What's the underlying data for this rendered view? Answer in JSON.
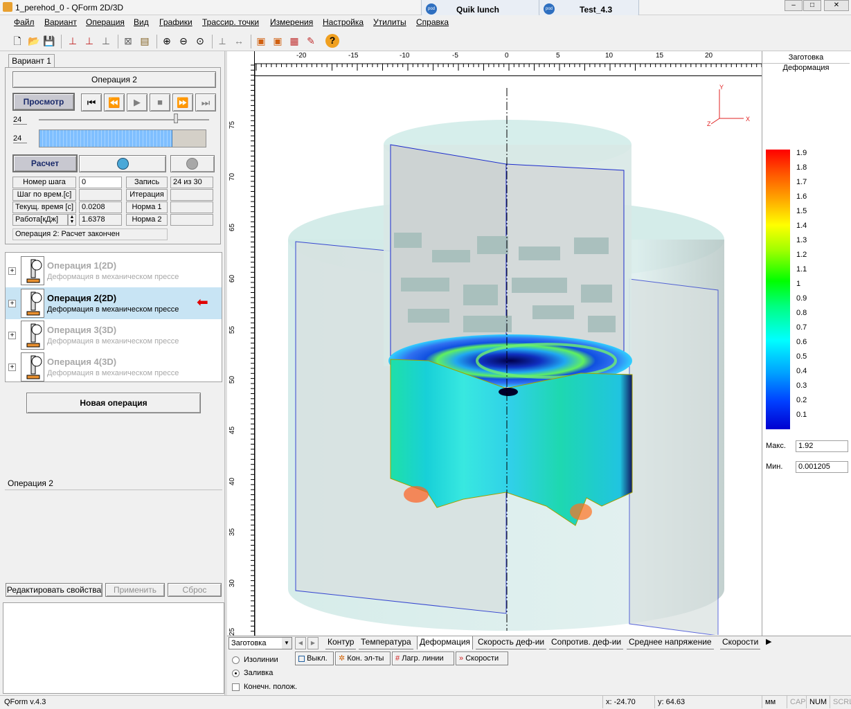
{
  "window": {
    "title": "1_perehod_0 - QForm 2D/3D"
  },
  "external_tabs": [
    {
      "label": "Quik lunch"
    },
    {
      "label": "Test_4.3"
    }
  ],
  "window_buttons": {
    "minimize": "–",
    "maximize": "□",
    "close": "✕"
  },
  "menu": [
    "Файл",
    "Вариант",
    "Операция",
    "Вид",
    "Графики",
    "Трассир. точки",
    "Измерения",
    "Настройка",
    "Утилиты",
    "Справка"
  ],
  "variant_tab": "Вариант 1",
  "operation_header": "Операция 2",
  "controls": {
    "preview_label": "Просмотр",
    "calc_label": "Расчет",
    "step_value_1": "24",
    "step_value_2": "24",
    "progress_fraction": 0.8
  },
  "info": {
    "step_num_label": "Номер шага",
    "step_num_value": "0",
    "record_label": "Запись",
    "record_value": "24 из 30",
    "time_step_label": "Шаг по врем.[с]",
    "time_step_value": "",
    "iteration_label": "Итерация",
    "iteration_value": "",
    "cur_time_label": "Текущ. время [с]",
    "cur_time_value": "0.0208",
    "norm1_label": "Норма 1",
    "norm1_value": "",
    "work_label": "Работа[кДж]",
    "work_value": "1.6378",
    "norm2_label": "Норма 2",
    "norm2_value": "",
    "status": "Операция 2: Расчет закончен"
  },
  "operations": [
    {
      "title": "Операция 1(2D)",
      "subtitle": "Деформация в механическом прессе",
      "active": false
    },
    {
      "title": "Операция 2(2D)",
      "subtitle": "Деформация в механическом прессе",
      "active": true
    },
    {
      "title": "Операция 3(3D)",
      "subtitle": "Деформация в механическом прессе",
      "active": false
    },
    {
      "title": "Операция 4(3D)",
      "subtitle": "Деформация в механическом прессе",
      "active": false
    }
  ],
  "new_operation_label": "Новая операция",
  "properties": {
    "title": "Операция 2",
    "edit_label": "Редактировать свойства",
    "apply_label": "Применить",
    "reset_label": "Сброс"
  },
  "ruler": {
    "x_ticks": [
      "-20",
      "-15",
      "-10",
      "-5",
      "0",
      "5",
      "10",
      "15",
      "20"
    ],
    "y_ticks": [
      "75",
      "70",
      "65",
      "60",
      "55",
      "50",
      "45",
      "40",
      "35",
      "30",
      "25"
    ]
  },
  "axes": {
    "x": "X",
    "y": "Y",
    "z": "Z"
  },
  "legend": {
    "title1": "Заготовка",
    "title2": "Деформация",
    "scale": [
      "1.9",
      "1.8",
      "1.7",
      "1.6",
      "1.5",
      "1.4",
      "1.3",
      "1.2",
      "1.1",
      "1",
      "0.9",
      "0.8",
      "0.7",
      "0.6",
      "0.5",
      "0.4",
      "0.3",
      "0.2",
      "0.1"
    ],
    "max_label": "Макс.",
    "max_value": "1.92",
    "min_label": "Мин.",
    "min_value": "0.001205"
  },
  "object_select": "Заготовка",
  "view_tabs": [
    "Контур",
    "Температура",
    "Деформация",
    "Скорость деф-ии",
    "Сопротив. деф-ии",
    "Среднее напряжение",
    "Скорости"
  ],
  "active_view_tab": "Деформация",
  "display": {
    "isolines": "Изолинии",
    "fill": "Заливка",
    "final_pos": "Конечн. полож.",
    "off_btn": "Выкл.",
    "end_elements_btn": "Кон. эл-ты",
    "lagr_btn": "Лагр. линии",
    "speeds_btn": "Скорости"
  },
  "statusbar": {
    "version": "QForm v.4.3",
    "x": "x: -24.70",
    "y": "y: 64.63",
    "units": "мм",
    "cap": "CAP",
    "num": "NUM",
    "scrl": "SCRL"
  }
}
